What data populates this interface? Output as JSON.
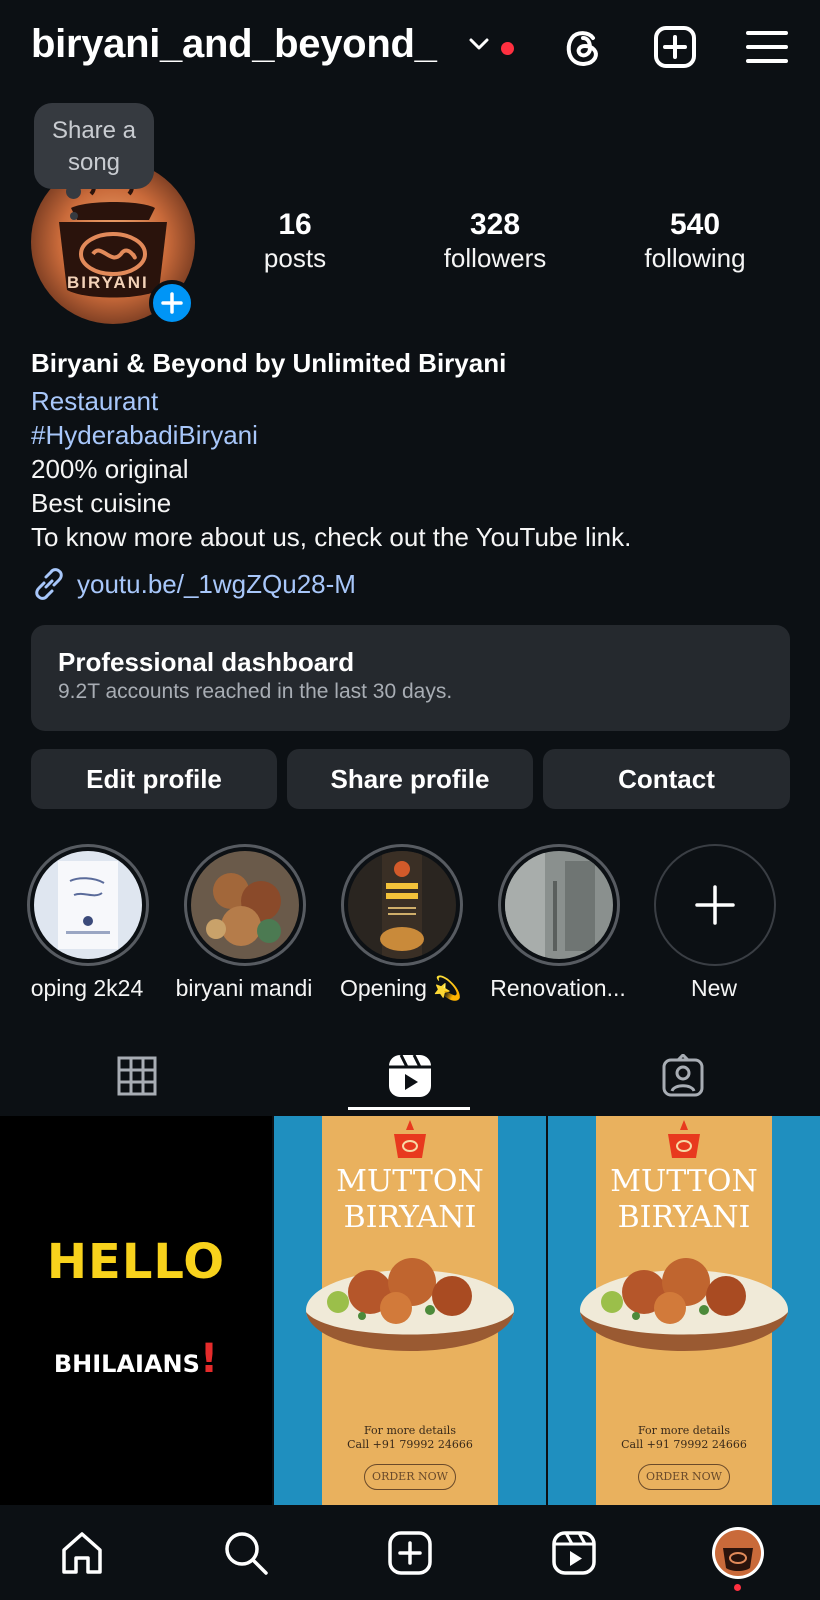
{
  "header": {
    "username": "biryani_and_beyond_"
  },
  "note": {
    "text": "Share a song"
  },
  "profile": {
    "logo_text": "BIRYANI"
  },
  "stats": [
    {
      "value": "16",
      "label": "posts"
    },
    {
      "value": "328",
      "label": "followers"
    },
    {
      "value": "540",
      "label": "following"
    }
  ],
  "bio": {
    "name": "Biryani & Beyond by Unlimited Biryani",
    "category": "Restaurant",
    "hashtag": "#HyderabadiBiryani",
    "lines": [
      "200% original",
      "Best cuisine",
      "To know more about us, check out the YouTube link."
    ],
    "link": "youtu.be/_1wgZQu28-M"
  },
  "dashboard": {
    "title": "Professional dashboard",
    "subtitle": "9.2T accounts reached in the last 30 days."
  },
  "buttons": {
    "edit": "Edit profile",
    "share": "Share profile",
    "contact": "Contact"
  },
  "highlights": [
    {
      "label": "oping 2k24"
    },
    {
      "label": "biryani mandi"
    },
    {
      "label": "Opening 💫"
    },
    {
      "label": "Renovation..."
    },
    {
      "label": "New"
    }
  ],
  "grid": {
    "hello": "HELLO",
    "bhilaians": "BHILAIANS",
    "poster_title_1": "MUTTON",
    "poster_title_2": "BIRYANI",
    "poster_details_1": "For more details",
    "poster_details_2": "Call +91 79992 24666",
    "poster_order": "ORDER NOW"
  },
  "colors": {
    "background": "#0c1014",
    "link_blue": "#a8c7fa",
    "accent_blue": "#0095f6",
    "notification_red": "#ff3040",
    "card": "#25292e"
  },
  "icons": [
    "chevron-down-icon",
    "threads-icon",
    "create-icon",
    "menu-icon",
    "link-icon",
    "grid-icon",
    "reels-icon",
    "tagged-icon",
    "home-icon",
    "search-icon",
    "reels-nav-icon"
  ]
}
